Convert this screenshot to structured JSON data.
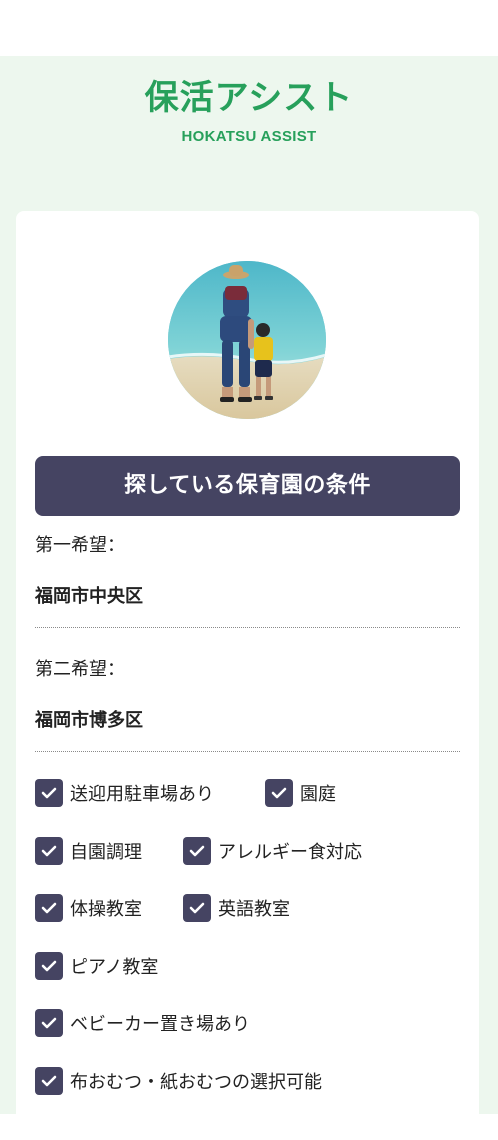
{
  "header": {
    "title": "保活アシスト",
    "subtitle": "HOKATSU ASSIST"
  },
  "profile": {
    "photo_icon": "beach-photo"
  },
  "conditions": {
    "section_title": "探している保育園の条件",
    "first_choice_label": "第一希望：",
    "first_choice_value": "福岡市中央区",
    "second_choice_label": "第二希望：",
    "second_choice_value": "福岡市博多区",
    "options": [
      {
        "label": "送迎用駐車場あり",
        "checked": true
      },
      {
        "label": "園庭",
        "checked": true
      },
      {
        "label": "自園調理",
        "checked": true
      },
      {
        "label": "アレルギー食対応",
        "checked": true
      },
      {
        "label": "体操教室",
        "checked": true
      },
      {
        "label": "英語教室",
        "checked": true
      },
      {
        "label": "ピアノ教室",
        "checked": true
      },
      {
        "label": "ベビーカー置き場あり",
        "checked": true
      },
      {
        "label": "布おむつ・紙おむつの選択可能",
        "checked": true
      }
    ]
  },
  "colors": {
    "brand_green": "#27a05b",
    "background_green": "#edf7ee",
    "accent_navy": "#454462"
  }
}
